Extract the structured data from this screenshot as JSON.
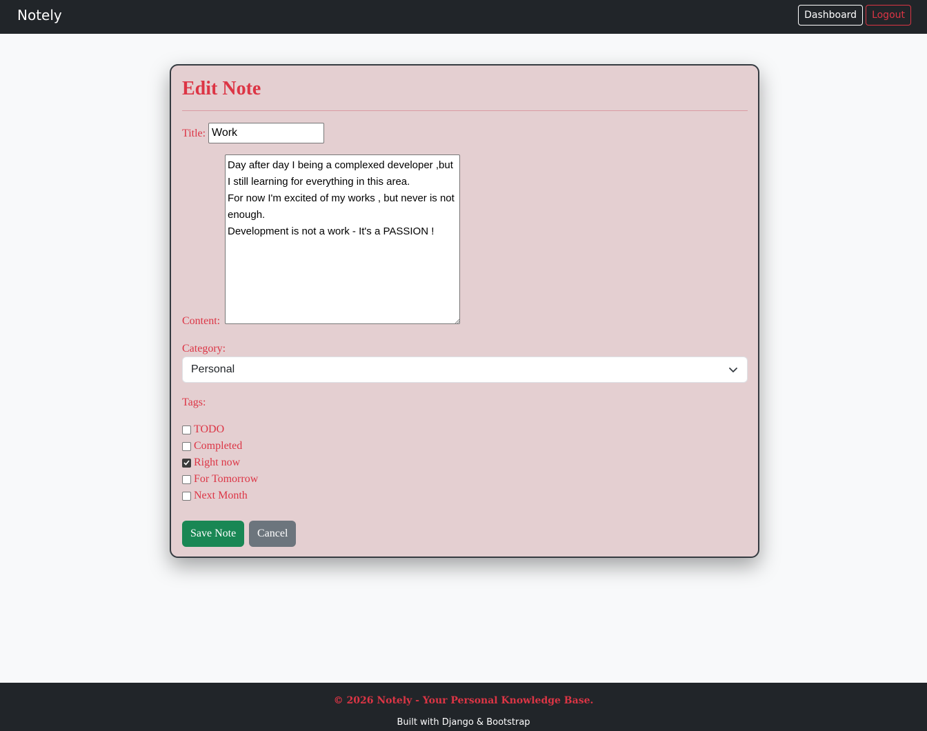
{
  "nav": {
    "brand": "Notely",
    "dashboard_label": "Dashboard",
    "logout_label": "Logout"
  },
  "form": {
    "heading": "Edit Note",
    "title_label": "Title:",
    "title_value": "Work",
    "content_label": "Content:",
    "content_value": "Day after day I being a complexed developer ,but I still learning for everything in this area.\nFor now I'm excited of my works , but never is not enough.\nDevelopment is not a work - It's a PASSION !",
    "category_label": "Category:",
    "category_selected": "Personal",
    "tags_label": "Tags:",
    "tags": [
      {
        "label": "TODO",
        "checked": false
      },
      {
        "label": "Completed",
        "checked": false
      },
      {
        "label": "Right now",
        "checked": true
      },
      {
        "label": "For Tomorrow",
        "checked": false
      },
      {
        "label": "Next Month",
        "checked": false
      }
    ],
    "save_label": "Save Note",
    "cancel_label": "Cancel"
  },
  "footer": {
    "line1": "© 2026 Notely - Your Personal Knowledge Base.",
    "line2": "Built with Django & Bootstrap"
  },
  "icons": {
    "select_arrow": "chevron-down-icon",
    "checkmark": "check-icon",
    "resize": "resize-grip-icon"
  },
  "colors": {
    "accent": "#dc3545",
    "navbar": "#212529",
    "card_bg": "#e4cfd1",
    "save": "#198754",
    "cancel": "#6c757d"
  }
}
